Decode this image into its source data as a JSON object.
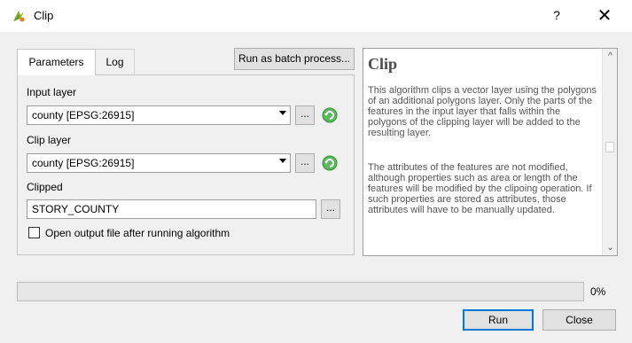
{
  "window": {
    "title": "Clip",
    "help_label": "?",
    "close_label": "✕"
  },
  "tabs": [
    {
      "label": "Parameters",
      "active": true
    },
    {
      "label": "Log",
      "active": false
    }
  ],
  "batch_button_label": "Run as batch process...",
  "form": {
    "input_layer": {
      "label": "Input layer",
      "value": "county [EPSG:26915]"
    },
    "clip_layer": {
      "label": "Clip layer",
      "value": "county [EPSG:26915]"
    },
    "clipped": {
      "label": "Clipped",
      "value": "STORY_COUNTY"
    },
    "dots_label": "...",
    "open_output_label": "Open output file after running algorithm",
    "open_output_checked": false
  },
  "help": {
    "title": "Clip",
    "paragraphs": [
      "This algorithm clips a vector layer using the polygons of an additional polygons layer. Only the parts of the features in the input layer that falls within the polygons of the clipping layer will be added to the resulting layer.",
      "The attributes of the features are not modified, although properties such as area or length of the features will be modified by the clipoing operation. If such properties are stored as attributes, those attributes will have to be manually updated."
    ]
  },
  "progress": {
    "value": 0,
    "label": "0%"
  },
  "buttons": {
    "run": "Run",
    "close": "Close"
  },
  "colors": {
    "accent": "#0078d7",
    "progress": "#06b025"
  }
}
